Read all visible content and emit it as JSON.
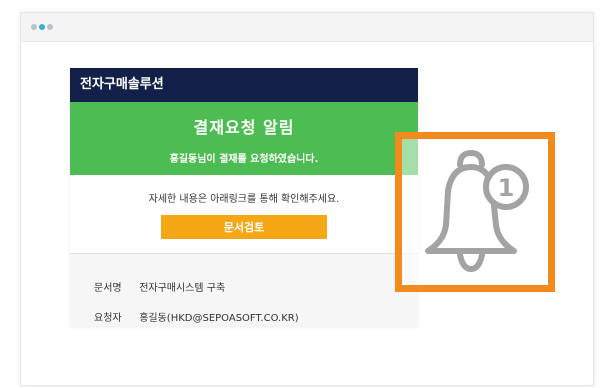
{
  "mail": {
    "brand": "전자구매솔루션",
    "banner": {
      "title": "결재요청 알림",
      "subtitle": "홍길동님이 결재를 요청하였습니다."
    },
    "message": "자세한 내용은 아래링크를 통해 확인해주세요.",
    "review_button": "문서검토",
    "details": [
      {
        "key": "문서명",
        "value": "전자구매시스템 구축"
      },
      {
        "key": "요청자",
        "value": "홍길동(HKD@SEPOASOFT.CO.KR)"
      }
    ]
  },
  "notification": {
    "icon": "bell-icon",
    "count": "1"
  },
  "colors": {
    "header": "#13214a",
    "banner": "#4dbc53",
    "button": "#f5a716",
    "highlight": "#f38b1c",
    "bell": "#a3a3a3"
  }
}
